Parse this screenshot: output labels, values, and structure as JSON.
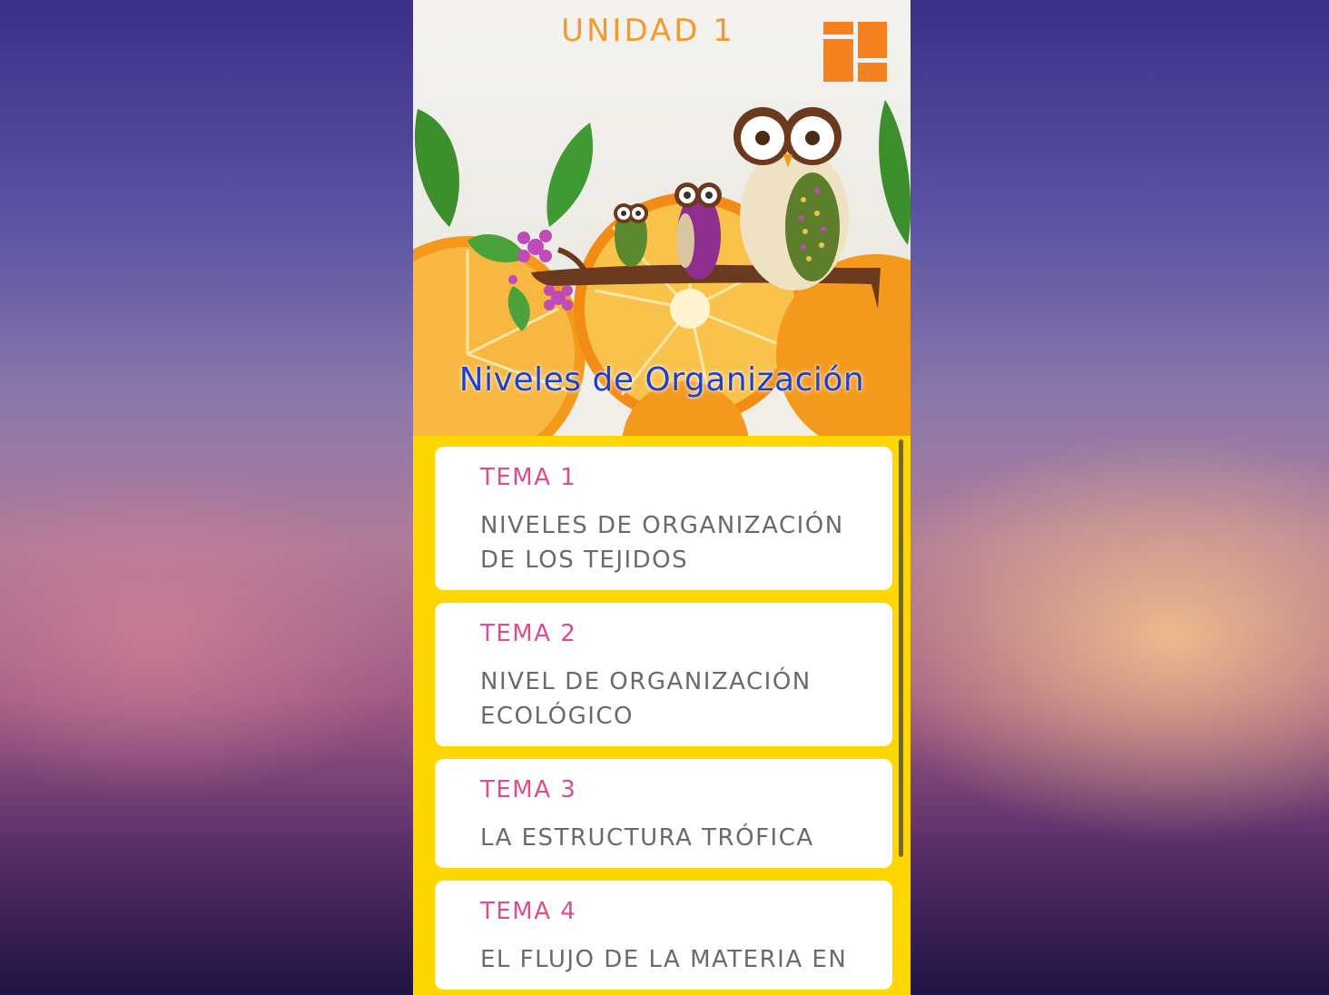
{
  "header": {
    "unit_title": "UNIDAD 1",
    "menu_icon": "grid-menu-icon"
  },
  "hero": {
    "title": "Niveles de Organización"
  },
  "topics": [
    {
      "label": "TEMA 1",
      "title": "NIVELES DE ORGANIZACIÓN DE LOS TEJIDOS"
    },
    {
      "label": "TEMA 2",
      "title": "NIVEL DE ORGANIZACIÓN ECOLÓGICO"
    },
    {
      "label": "TEMA 3",
      "title": "LA ESTRUCTURA TRÓFICA"
    },
    {
      "label": "TEMA 4",
      "title": "EL FLUJO DE LA MATERIA EN"
    }
  ],
  "colors": {
    "unit_title": "#f49a2c",
    "hero_title": "#1f3fcf",
    "tema_label": "#e04a8f",
    "list_background": "#ffd700"
  }
}
